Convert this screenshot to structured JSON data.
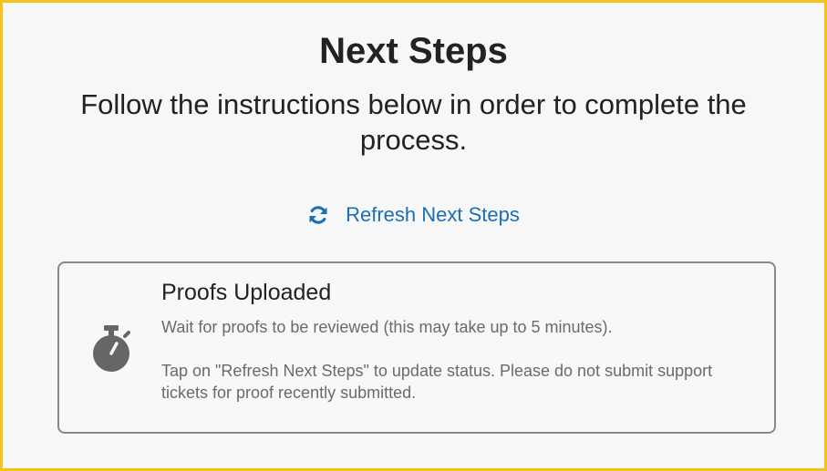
{
  "header": {
    "title": "Next Steps",
    "subtitle": "Follow the instructions below in order to complete the process."
  },
  "refresh": {
    "icon": "refresh-icon",
    "label": "Refresh Next Steps",
    "color": "#1a6fb8"
  },
  "status_card": {
    "icon": "stopwatch-icon",
    "title": "Proofs Uploaded",
    "message": "Wait for proofs to be reviewed (this may take up to 5 minutes).",
    "note": "Tap on \"Refresh Next Steps\" to update status. Please do not submit support tickets for proof recently submitted."
  },
  "colors": {
    "frame_border": "#f5c218",
    "link": "#1a6fb8",
    "muted_text": "#6a6a6a"
  }
}
